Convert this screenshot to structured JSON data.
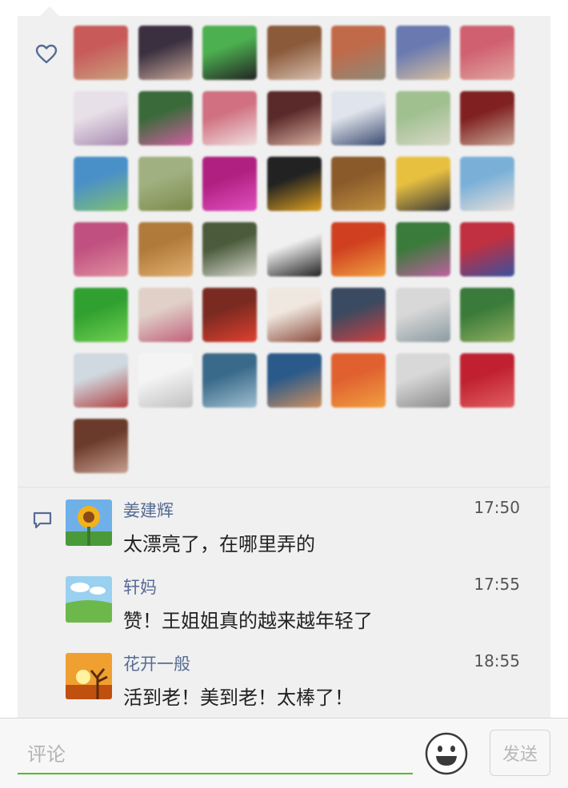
{
  "likes": {
    "icon": "heart-outline-icon",
    "avatars": [
      [
        "#c85a5a",
        "#c9a27e"
      ],
      [
        "#3a3040",
        "#c9a89a"
      ],
      [
        "#4caf50",
        "#222222"
      ],
      [
        "#8a5a3a",
        "#d9c0b0"
      ],
      [
        "#c06a4a",
        "#8e8a7a"
      ],
      [
        "#6a7ab0",
        "#d8c0a0"
      ],
      [
        "#d06070",
        "#e0a8a0"
      ],
      [
        "#e8e0e8",
        "#a88ab0"
      ],
      [
        "#3a6a3a",
        "#d060a0"
      ],
      [
        "#d07080",
        "#f0e0e0"
      ],
      [
        "#5a2a2a",
        "#d8b0a0"
      ],
      [
        "#e0e4ec",
        "#3a4a70"
      ],
      [
        "#a0c090",
        "#d8d8c8"
      ],
      [
        "#802020",
        "#c8a898"
      ],
      [
        "#4a90c8",
        "#80c070"
      ],
      [
        "#a0b080",
        "#7a8a4a"
      ],
      [
        "#b02080",
        "#e050c0"
      ],
      [
        "#222222",
        "#e0a020"
      ],
      [
        "#8a5a2a",
        "#c09040"
      ],
      [
        "#e8c040",
        "#3a3a3a"
      ],
      [
        "#7ab0d8",
        "#e8e0d8"
      ],
      [
        "#c05080",
        "#e090a0"
      ],
      [
        "#b07a3a",
        "#e0b070"
      ],
      [
        "#4a5a3a",
        "#d8d8d0"
      ],
      [
        "#f0f0f0",
        "#202020"
      ],
      [
        "#d04020",
        "#f0a040"
      ],
      [
        "#3a7a3a",
        "#c060a0"
      ],
      [
        "#c03040",
        "#3a50a0"
      ],
      [
        "#30a030",
        "#70d050"
      ],
      [
        "#e0d0c8",
        "#c0607a"
      ],
      [
        "#7a2a20",
        "#e04030"
      ],
      [
        "#f0e8e0",
        "#8a4a3a"
      ],
      [
        "#3a4a60",
        "#d04040"
      ],
      [
        "#d8d8d8",
        "#8a9aa0"
      ],
      [
        "#3a7a3a",
        "#90b060"
      ],
      [
        "#d0d8e0",
        "#b04040"
      ],
      [
        "#f4f4f4",
        "#c0c0c0"
      ],
      [
        "#3a6a8a",
        "#a0c0d0"
      ],
      [
        "#2a5a8a",
        "#d09060"
      ],
      [
        "#e06030",
        "#f0a040"
      ],
      [
        "#d8d8d8",
        "#8a8a8a"
      ],
      [
        "#c02030",
        "#e06060"
      ],
      [
        "#6a3a2a",
        "#c8a090"
      ]
    ]
  },
  "comments": {
    "icon": "comment-bubble-icon",
    "items": [
      {
        "name": "姜建辉",
        "time": "17:50",
        "text": "太漂亮了，在哪里弄的",
        "avatar": "sunflower"
      },
      {
        "name": "轩妈",
        "time": "17:55",
        "text": "赞！王姐姐真的越来越年轻了",
        "avatar": "meadow"
      },
      {
        "name": "花开一般",
        "time": "18:55",
        "text": "活到老！美到老！太棒了！",
        "avatar": "sunset-tree"
      }
    ]
  },
  "composer": {
    "placeholder": "评论",
    "emoji_icon": "smiley-face-icon",
    "send_label": "发送"
  }
}
